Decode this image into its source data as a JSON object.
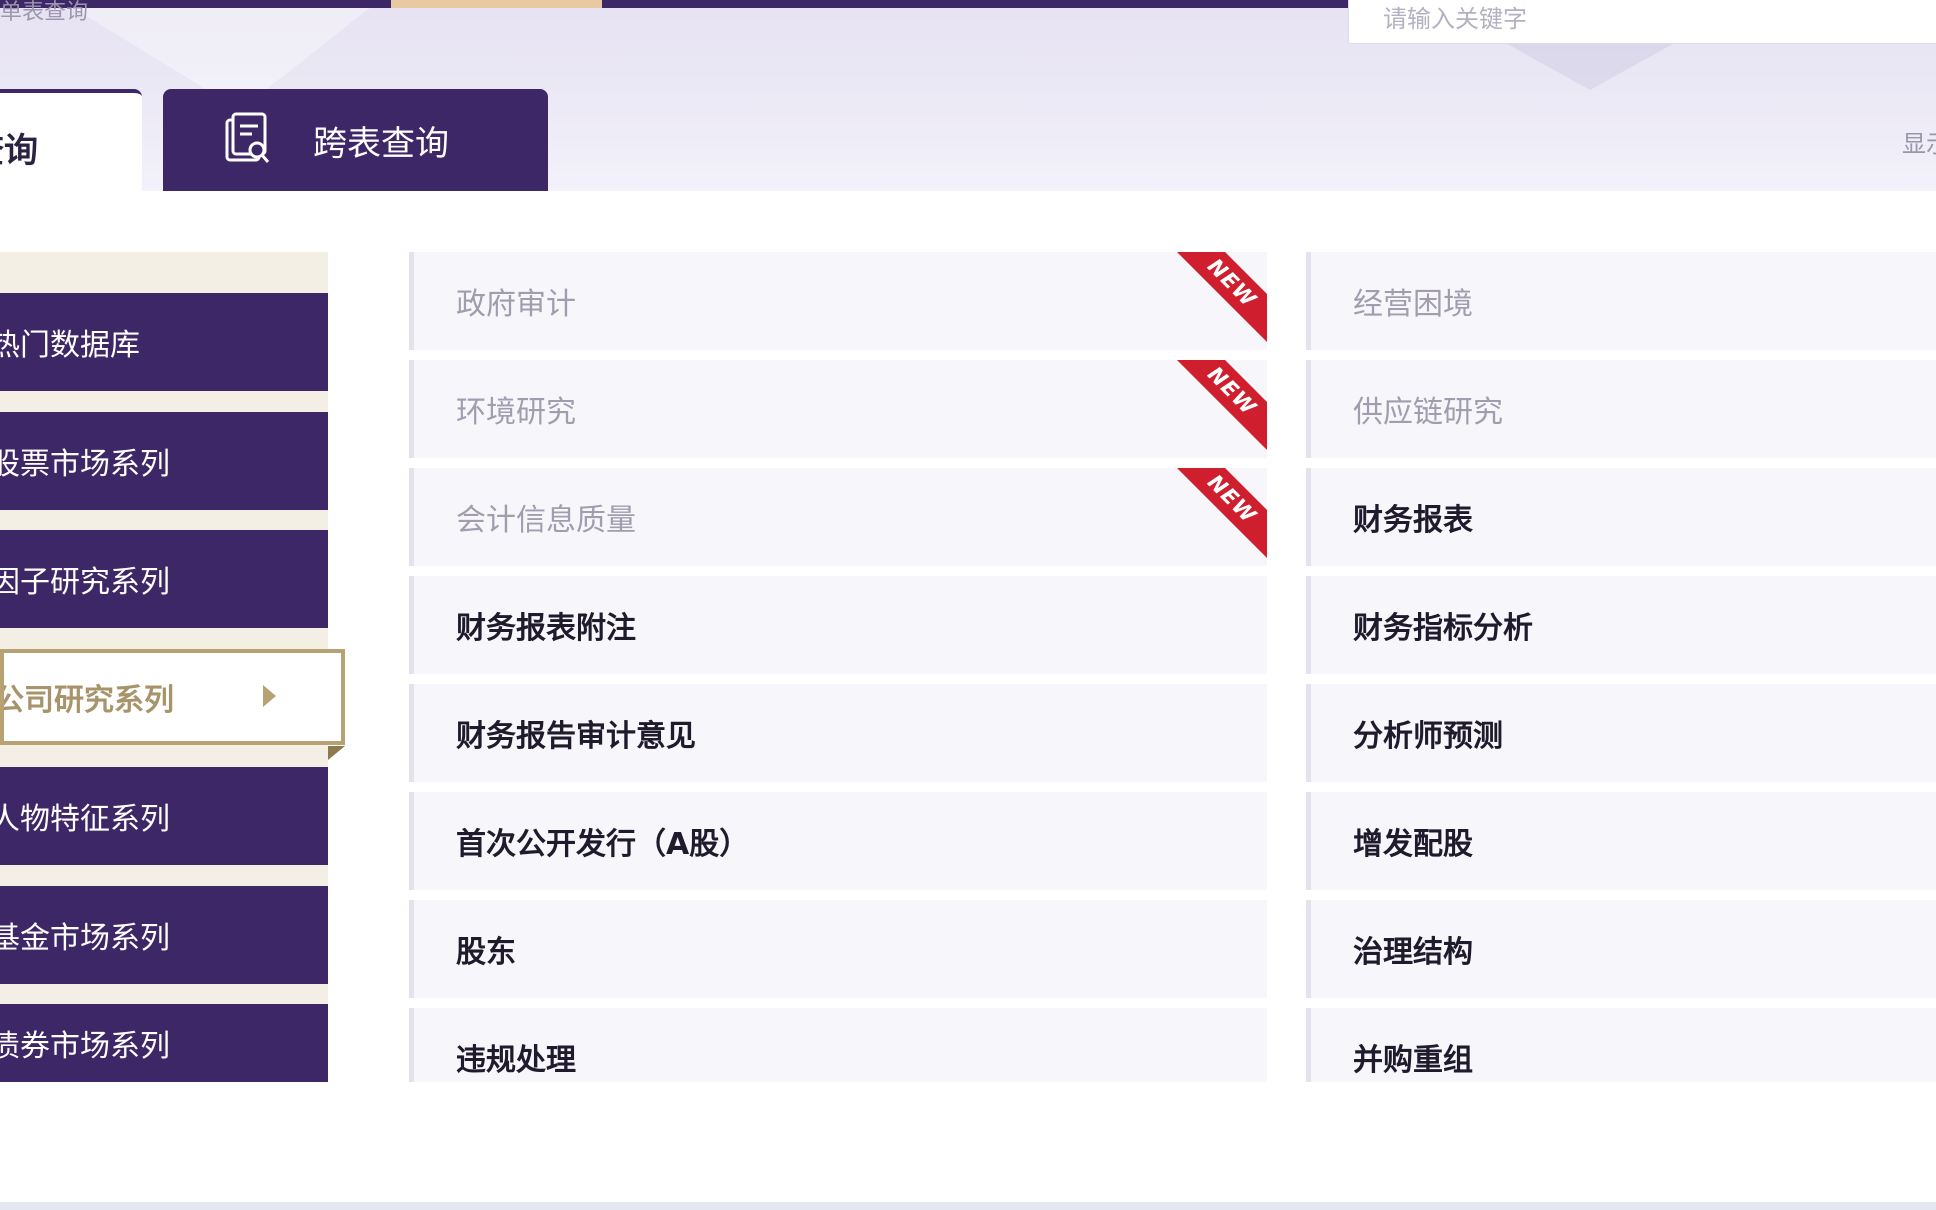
{
  "header": {
    "breadcrumb": "单表查询",
    "search_placeholder": "请输入关键字",
    "display_text": "显示"
  },
  "tabs": {
    "single": "查询",
    "cross": "跨表查询"
  },
  "sidebar": {
    "items": [
      {
        "label": "热门数据库"
      },
      {
        "label": "股票市场系列"
      },
      {
        "label": "因子研究系列"
      },
      {
        "label": "公司研究系列",
        "active": true
      },
      {
        "label": "人物特征系列"
      },
      {
        "label": "基金市场系列"
      },
      {
        "label": "债券市场系列"
      }
    ]
  },
  "categories": {
    "badge": "NEW",
    "left": [
      {
        "label": "政府审计",
        "new": true
      },
      {
        "label": "环境研究",
        "new": true
      },
      {
        "label": "会计信息质量",
        "new": true
      },
      {
        "label": "财务报表附注"
      },
      {
        "label": "财务报告审计意见"
      },
      {
        "label": "首次公开发行（A股）"
      },
      {
        "label": "股东"
      },
      {
        "label": "违规处理"
      }
    ],
    "right": [
      {
        "label": "经营困境"
      },
      {
        "label": "供应链研究"
      },
      {
        "label": "财务报表"
      },
      {
        "label": "财务指标分析"
      },
      {
        "label": "分析师预测"
      },
      {
        "label": "增发配股"
      },
      {
        "label": "治理结构"
      },
      {
        "label": "并购重组"
      }
    ]
  },
  "colors": {
    "primary": "#3e2766",
    "accent_gold": "#b8a274",
    "new_badge": "#cf1f2e",
    "sidebar_bg": "#f4efe4"
  }
}
